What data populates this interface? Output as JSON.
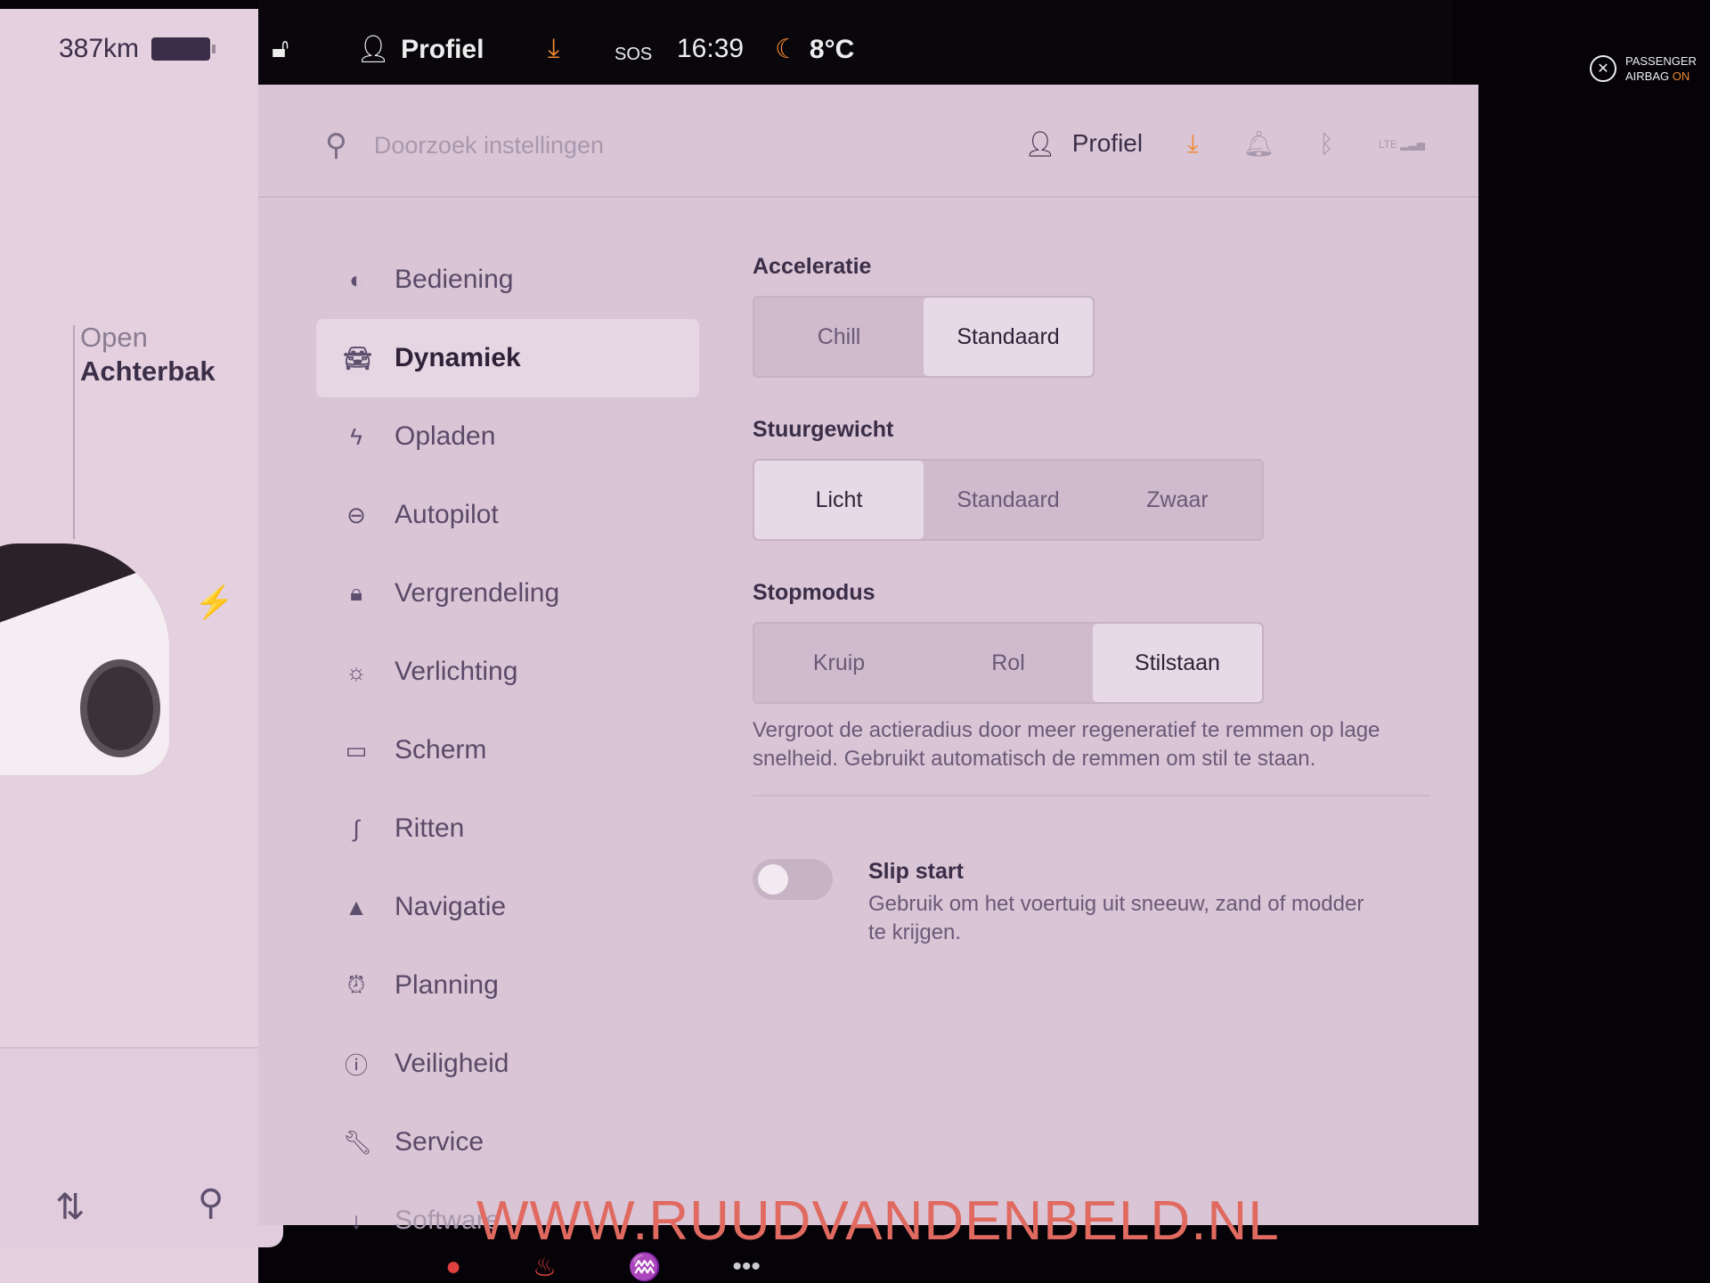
{
  "left_panel": {
    "range": "387km",
    "trunk_action": "Open",
    "trunk_label": "Achterbak"
  },
  "status_bar": {
    "profile": "Profiel",
    "sos": "SOS",
    "time": "16:39",
    "temperature": "8°C",
    "airbag_line1": "PASSENGER",
    "airbag_line2_prefix": "AIRBAG",
    "airbag_line2_state": "ON"
  },
  "header": {
    "search_placeholder": "Doorzoek instellingen",
    "profile": "Profiel",
    "signal": "LTE"
  },
  "sidebar": {
    "items": [
      {
        "label": "Bediening",
        "icon": "toggle-icon"
      },
      {
        "label": "Dynamiek",
        "icon": "car-icon",
        "active": true
      },
      {
        "label": "Opladen",
        "icon": "bolt-icon"
      },
      {
        "label": "Autopilot",
        "icon": "steering-wheel-icon"
      },
      {
        "label": "Vergrendeling",
        "icon": "lock-icon"
      },
      {
        "label": "Verlichting",
        "icon": "sun-icon"
      },
      {
        "label": "Scherm",
        "icon": "screen-icon"
      },
      {
        "label": "Ritten",
        "icon": "trips-icon"
      },
      {
        "label": "Navigatie",
        "icon": "navigation-icon"
      },
      {
        "label": "Planning",
        "icon": "alarm-clock-icon"
      },
      {
        "label": "Veiligheid",
        "icon": "alert-icon"
      },
      {
        "label": "Service",
        "icon": "wrench-icon"
      },
      {
        "label": "Software",
        "icon": "download-icon"
      }
    ]
  },
  "settings": {
    "acceleration": {
      "label": "Acceleratie",
      "options": [
        "Chill",
        "Standaard"
      ],
      "selected": "Standaard"
    },
    "steering": {
      "label": "Stuurgewicht",
      "options": [
        "Licht",
        "Standaard",
        "Zwaar"
      ],
      "selected": "Licht"
    },
    "stop_mode": {
      "label": "Stopmodus",
      "options": [
        "Kruip",
        "Rol",
        "Stilstaan"
      ],
      "selected": "Stilstaan",
      "description": "Vergroot de actieradius door meer regeneratief te remmen op lage snelheid. Gebruikt automatisch de remmen om stil te staan."
    },
    "slip_start": {
      "label": "Slip start",
      "description": "Gebruik om het voertuig uit sneeuw, zand of modder te krijgen.",
      "enabled": false
    }
  },
  "watermark": "WWW.RUUDVANDENBELD.NL",
  "colors": {
    "accent_orange": "#f08a30",
    "watermark": "#e06a60"
  }
}
